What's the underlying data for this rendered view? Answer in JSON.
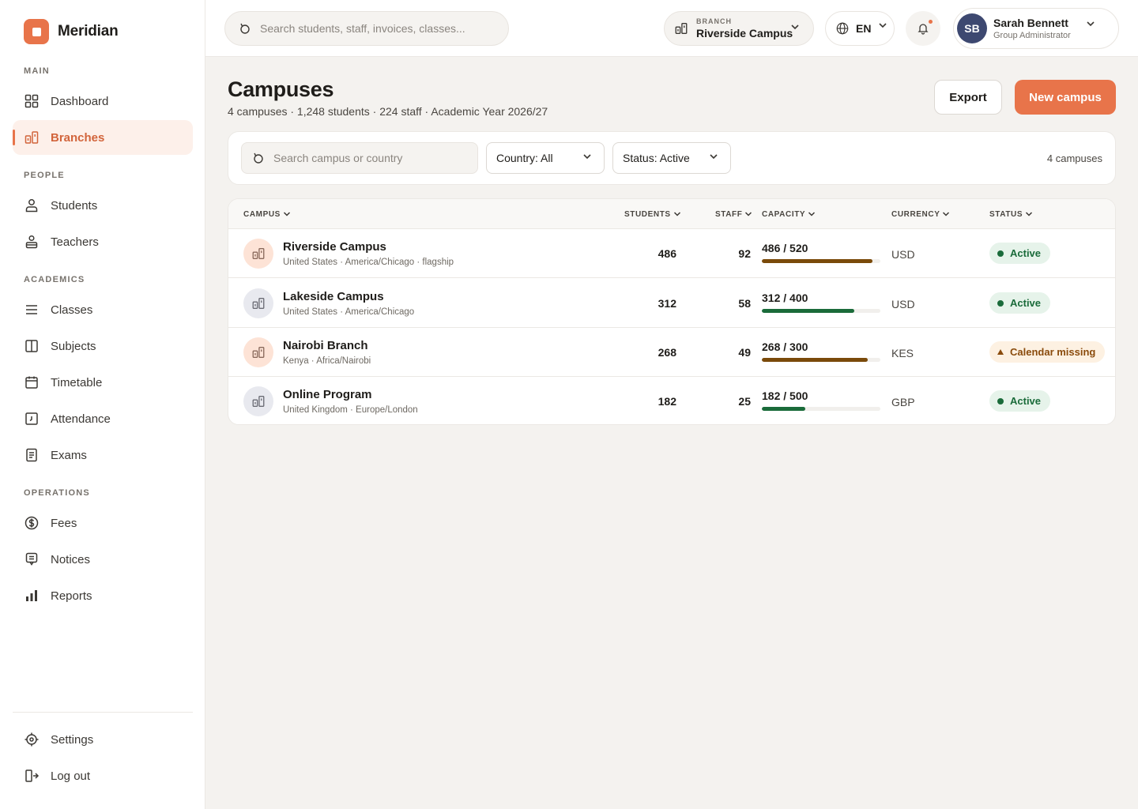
{
  "brand": {
    "name": "Meridian"
  },
  "sidebar": {
    "sections": [
      {
        "title": "MAIN"
      },
      {
        "title": "PEOPLE"
      },
      {
        "title": "ACADEMICS"
      },
      {
        "title": "OPERATIONS"
      }
    ],
    "items": [
      {
        "label": "Dashboard",
        "icon": "dashboard-icon"
      },
      {
        "label": "Branches",
        "icon": "branches-icon",
        "active": true
      },
      {
        "label": "Students",
        "icon": "student-icon"
      },
      {
        "label": "Teachers",
        "icon": "teacher-icon"
      },
      {
        "label": "Classes",
        "icon": "list-icon"
      },
      {
        "label": "Subjects",
        "icon": "book-icon"
      },
      {
        "label": "Timetable",
        "icon": "calendar-icon"
      },
      {
        "label": "Attendance",
        "icon": "attendance-icon"
      },
      {
        "label": "Exams",
        "icon": "exam-icon"
      },
      {
        "label": "Fees",
        "icon": "dollar-icon"
      },
      {
        "label": "Notices",
        "icon": "notice-icon"
      },
      {
        "label": "Reports",
        "icon": "bar-chart-icon"
      }
    ],
    "footer": [
      {
        "label": "Settings",
        "icon": "settings-icon"
      },
      {
        "label": "Log out",
        "icon": "logout-icon"
      }
    ]
  },
  "topbar": {
    "search_placeholder": "Search students, staff, invoices, classes...",
    "branch_label": "BRANCH",
    "branch_value": "Riverside Campus",
    "language": "EN",
    "user": {
      "initials": "SB",
      "name": "Sarah Bennett",
      "role": "Group Administrator"
    }
  },
  "page": {
    "title": "Campuses",
    "subtitle": "4 campuses · 1,248 students · 224 staff · Academic Year 2026/27",
    "export_label": "Export",
    "new_label": "New campus"
  },
  "filters": {
    "search_placeholder": "Search campus or country",
    "country": "Country: All",
    "status": "Status: Active",
    "count": "4 campuses"
  },
  "table": {
    "columns": [
      "CAMPUS",
      "STUDENTS",
      "STAFF",
      "CAPACITY",
      "CURRENCY",
      "STATUS"
    ],
    "rows": [
      {
        "name": "Riverside Campus",
        "meta": "United States · America/Chicago · flagship",
        "students": "486",
        "staff": "92",
        "capacity": "486 / 520",
        "fill": 0.935,
        "fill_color": "#7a4a0a",
        "currency": "USD",
        "status": "Active",
        "status_type": "active",
        "icon_tone": "orange"
      },
      {
        "name": "Lakeside Campus",
        "meta": "United States · America/Chicago",
        "students": "312",
        "staff": "58",
        "capacity": "312 / 400",
        "fill": 0.78,
        "fill_color": "#1a6b3a",
        "currency": "USD",
        "status": "Active",
        "status_type": "active",
        "icon_tone": "grey"
      },
      {
        "name": "Nairobi Branch",
        "meta": "Kenya · Africa/Nairobi",
        "students": "268",
        "staff": "49",
        "capacity": "268 / 300",
        "fill": 0.893,
        "fill_color": "#7a4a0a",
        "currency": "KES",
        "status": "Calendar missing",
        "status_type": "warn",
        "icon_tone": "orange"
      },
      {
        "name": "Online Program",
        "meta": "United Kingdom · Europe/London",
        "students": "182",
        "staff": "25",
        "capacity": "182 / 500",
        "fill": 0.364,
        "fill_color": "#1a6b3a",
        "currency": "GBP",
        "status": "Active",
        "status_type": "active",
        "icon_tone": "grey"
      }
    ]
  }
}
